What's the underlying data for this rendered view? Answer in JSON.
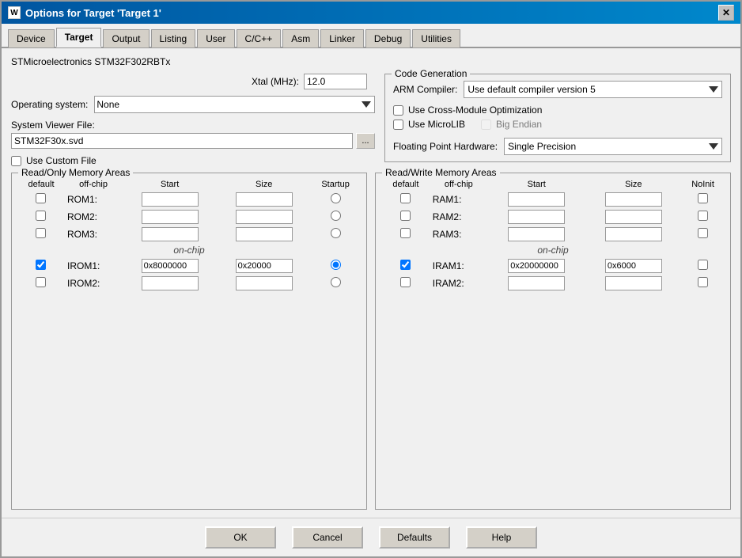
{
  "title": "Options for Target 'Target 1'",
  "tabs": [
    {
      "label": "Device",
      "active": false
    },
    {
      "label": "Target",
      "active": true
    },
    {
      "label": "Output",
      "active": false
    },
    {
      "label": "Listing",
      "active": false
    },
    {
      "label": "User",
      "active": false
    },
    {
      "label": "C/C++",
      "active": false
    },
    {
      "label": "Asm",
      "active": false
    },
    {
      "label": "Linker",
      "active": false
    },
    {
      "label": "Debug",
      "active": false
    },
    {
      "label": "Utilities",
      "active": false
    }
  ],
  "device_name": "STMicroelectronics STM32F302RBTx",
  "xtal_label": "Xtal (MHz):",
  "xtal_value": "12.0",
  "os_label": "Operating system:",
  "os_value": "None",
  "svf_label": "System Viewer File:",
  "svf_value": "STM32F30x.svd",
  "use_custom_file_label": "Use Custom File",
  "use_custom_file_checked": false,
  "code_gen": {
    "legend": "Code Generation",
    "compiler_label": "ARM Compiler:",
    "compiler_value": "Use default compiler version 5",
    "cross_module_label": "Use Cross-Module Optimization",
    "cross_module_checked": false,
    "microlib_label": "Use MicroLIB",
    "microlib_checked": false,
    "big_endian_label": "Big Endian",
    "big_endian_checked": false,
    "big_endian_disabled": true,
    "fp_label": "Floating Point Hardware:",
    "fp_value": "Single Precision"
  },
  "read_only": {
    "legend": "Read/Only Memory Areas",
    "headers": [
      "default",
      "off-chip",
      "Start",
      "Size",
      "Startup"
    ],
    "rows": [
      {
        "label": "ROM1:",
        "default": false,
        "start": "",
        "size": "",
        "startup": false,
        "on_chip": false
      },
      {
        "label": "ROM2:",
        "default": false,
        "start": "",
        "size": "",
        "startup": false,
        "on_chip": false
      },
      {
        "label": "ROM3:",
        "default": false,
        "start": "",
        "size": "",
        "startup": false,
        "on_chip": false
      }
    ],
    "on_chip_label": "on-chip",
    "on_chip_rows": [
      {
        "label": "IROM1:",
        "default": true,
        "start": "0x8000000",
        "size": "0x20000",
        "startup": true,
        "on_chip": true
      },
      {
        "label": "IROM2:",
        "default": false,
        "start": "",
        "size": "",
        "startup": false,
        "on_chip": true
      }
    ]
  },
  "read_write": {
    "legend": "Read/Write Memory Areas",
    "headers": [
      "default",
      "off-chip",
      "Start",
      "Size",
      "NoInit"
    ],
    "rows": [
      {
        "label": "RAM1:",
        "default": false,
        "start": "",
        "size": "",
        "noinit": false,
        "on_chip": false
      },
      {
        "label": "RAM2:",
        "default": false,
        "start": "",
        "size": "",
        "noinit": false,
        "on_chip": false
      },
      {
        "label": "RAM3:",
        "default": false,
        "start": "",
        "size": "",
        "noinit": false,
        "on_chip": false
      }
    ],
    "on_chip_label": "on-chip",
    "on_chip_rows": [
      {
        "label": "IRAM1:",
        "default": true,
        "start": "0x20000000",
        "size": "0x6000",
        "noinit": false,
        "on_chip": true
      },
      {
        "label": "IRAM2:",
        "default": false,
        "start": "",
        "size": "",
        "noinit": false,
        "on_chip": true
      }
    ]
  },
  "buttons": {
    "ok": "OK",
    "cancel": "Cancel",
    "defaults": "Defaults",
    "help": "Help"
  }
}
